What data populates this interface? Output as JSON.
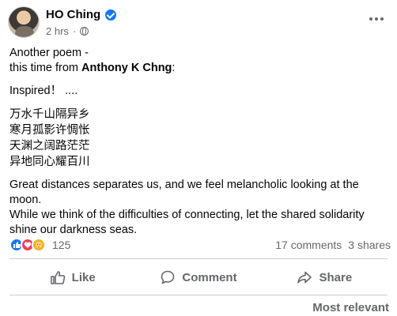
{
  "post": {
    "author": "HO Ching",
    "time": "2 hrs",
    "separator": "·",
    "intro_line1": "Another poem -",
    "intro_line2_prefix": "this time from ",
    "intro_author": "Anthony K Chng",
    "intro_line2_suffix": ":",
    "inspired": "Inspired！ ....",
    "poem_lines": [
      "万水千山隔异乡",
      "寒月孤影许惆怅",
      "天渊之阔路茫茫",
      "异地同心耀百川"
    ],
    "paragraph1": "Great  distances separates us, and we feel melancholic looking at the moon.",
    "paragraph2": "While we think of the difficulties of connecting, let the shared solidarity shine our darkness seas."
  },
  "stats": {
    "reactions_count": "125",
    "comments": "17 comments",
    "shares": "3 shares"
  },
  "actions": {
    "like": "Like",
    "comment": "Comment",
    "share": "Share"
  },
  "footer": {
    "sort_label": "Most relevant"
  },
  "colors": {
    "brand": "#1877f2",
    "love": "#f33e58",
    "care": "#f7b125",
    "muted": "#65676b"
  }
}
